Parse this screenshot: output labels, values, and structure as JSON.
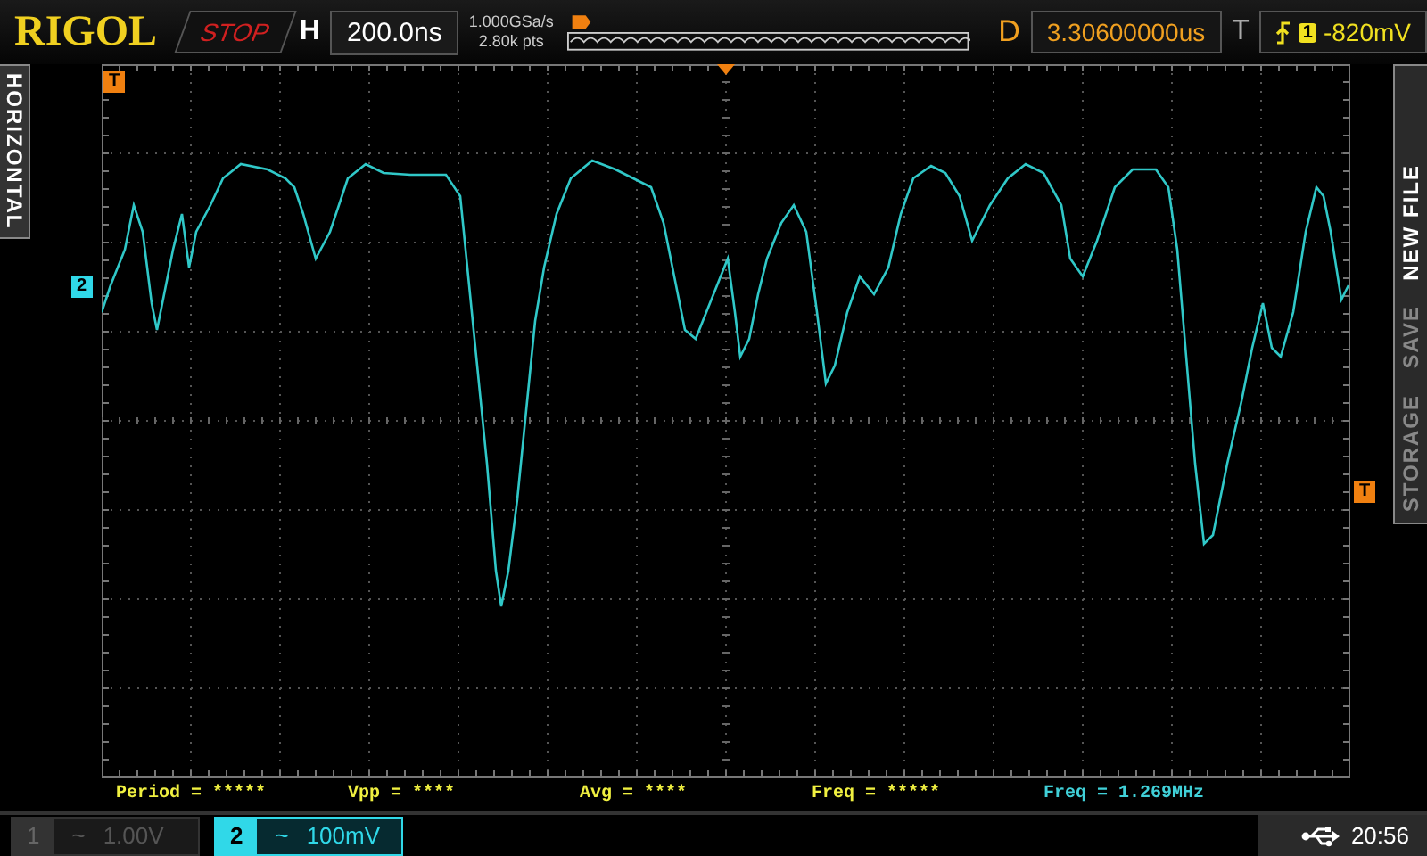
{
  "top_bar": {
    "brand": "RIGOL",
    "run_state": {
      "label": "STOP",
      "kind": "stop"
    },
    "horizontal_label": "H",
    "timebase": "200.0ns",
    "sample_rate": "1.000GSa/s",
    "memory_depth": "2.80k pts",
    "delay_label": "D",
    "delay": "3.30600000us",
    "trigger_label": "T",
    "trigger_source": "1",
    "trigger_level": "-820mV"
  },
  "left_menu": {
    "label": "HORIZONTAL"
  },
  "markers": {
    "trigger_position": "T",
    "channel": "2",
    "trigger_level": "T"
  },
  "right_menu": [
    {
      "label": "STORAGE",
      "selected": false
    },
    {
      "label": "SAVE",
      "selected": false
    },
    {
      "label": "NEW FILE",
      "selected": true
    }
  ],
  "measurements": [
    {
      "label": "Period = *****",
      "color": "#f0f040"
    },
    {
      "label": "Vpp = ****",
      "color": "#f0f040"
    },
    {
      "label": "Avg = ****",
      "color": "#f0f040"
    },
    {
      "label": "Freq = *****",
      "color": "#f0f040"
    },
    {
      "label": "Freq = 1.269MHz",
      "color": "#40d0d8"
    }
  ],
  "channels": [
    {
      "number": "1",
      "coupling": "~",
      "scale": "1.00V",
      "on": false
    },
    {
      "number": "2",
      "coupling": "~",
      "scale": "100mV",
      "on": true
    }
  ],
  "status": {
    "time": "20:56"
  }
}
